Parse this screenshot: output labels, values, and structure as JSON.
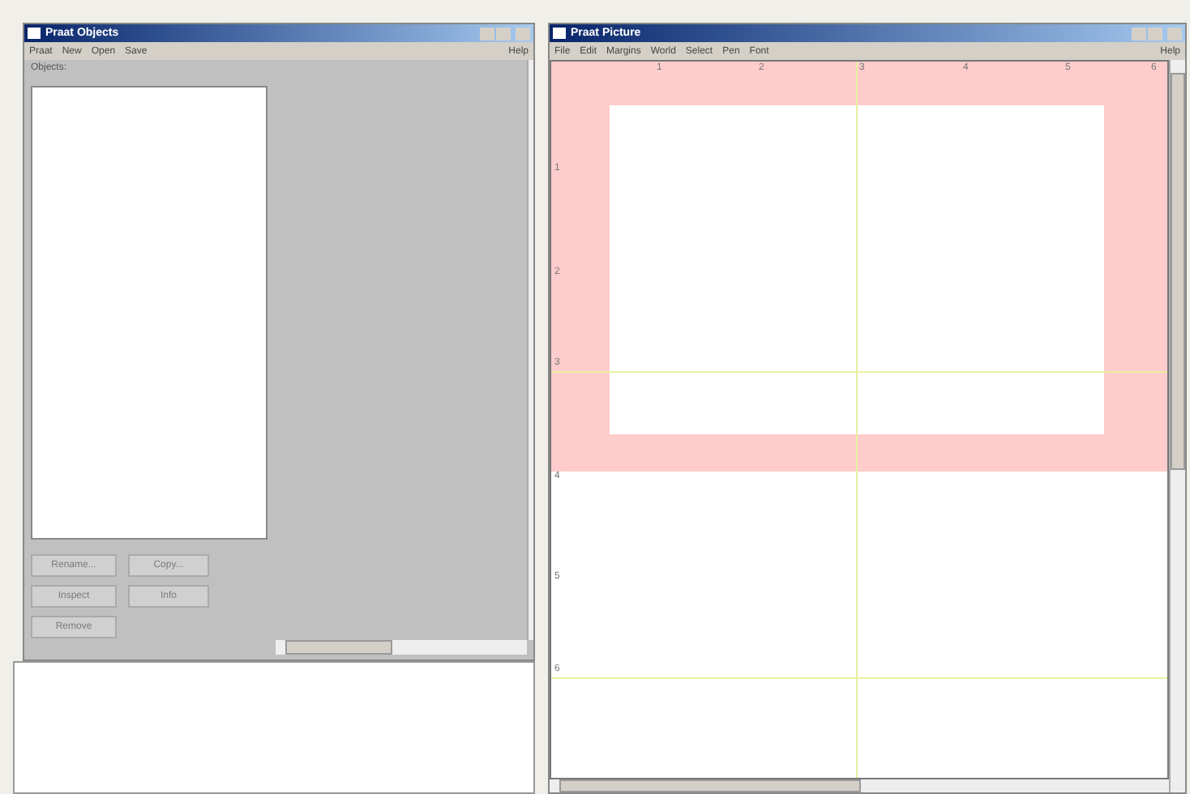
{
  "objects_window": {
    "title": "Praat Objects",
    "menus": [
      "Praat",
      "New",
      "Open",
      "Save"
    ],
    "help": "Help",
    "list_label": "Objects:",
    "buttons": [
      {
        "label": "Rename...",
        "disabled": true
      },
      {
        "label": "Copy...",
        "disabled": true
      },
      {
        "label": "Inspect",
        "disabled": true
      },
      {
        "label": "Info",
        "disabled": true
      },
      {
        "label": "Remove",
        "disabled": true
      }
    ]
  },
  "picture_window": {
    "title": "Praat Picture",
    "menus": [
      "File",
      "Edit",
      "Margins",
      "World",
      "Select",
      "Pen",
      "Font"
    ],
    "help": "Help",
    "top_ruler": [
      "1",
      "2",
      "3",
      "4",
      "5",
      "6"
    ],
    "left_ruler": [
      "1",
      "2",
      "3",
      "4",
      "5",
      "6"
    ]
  }
}
